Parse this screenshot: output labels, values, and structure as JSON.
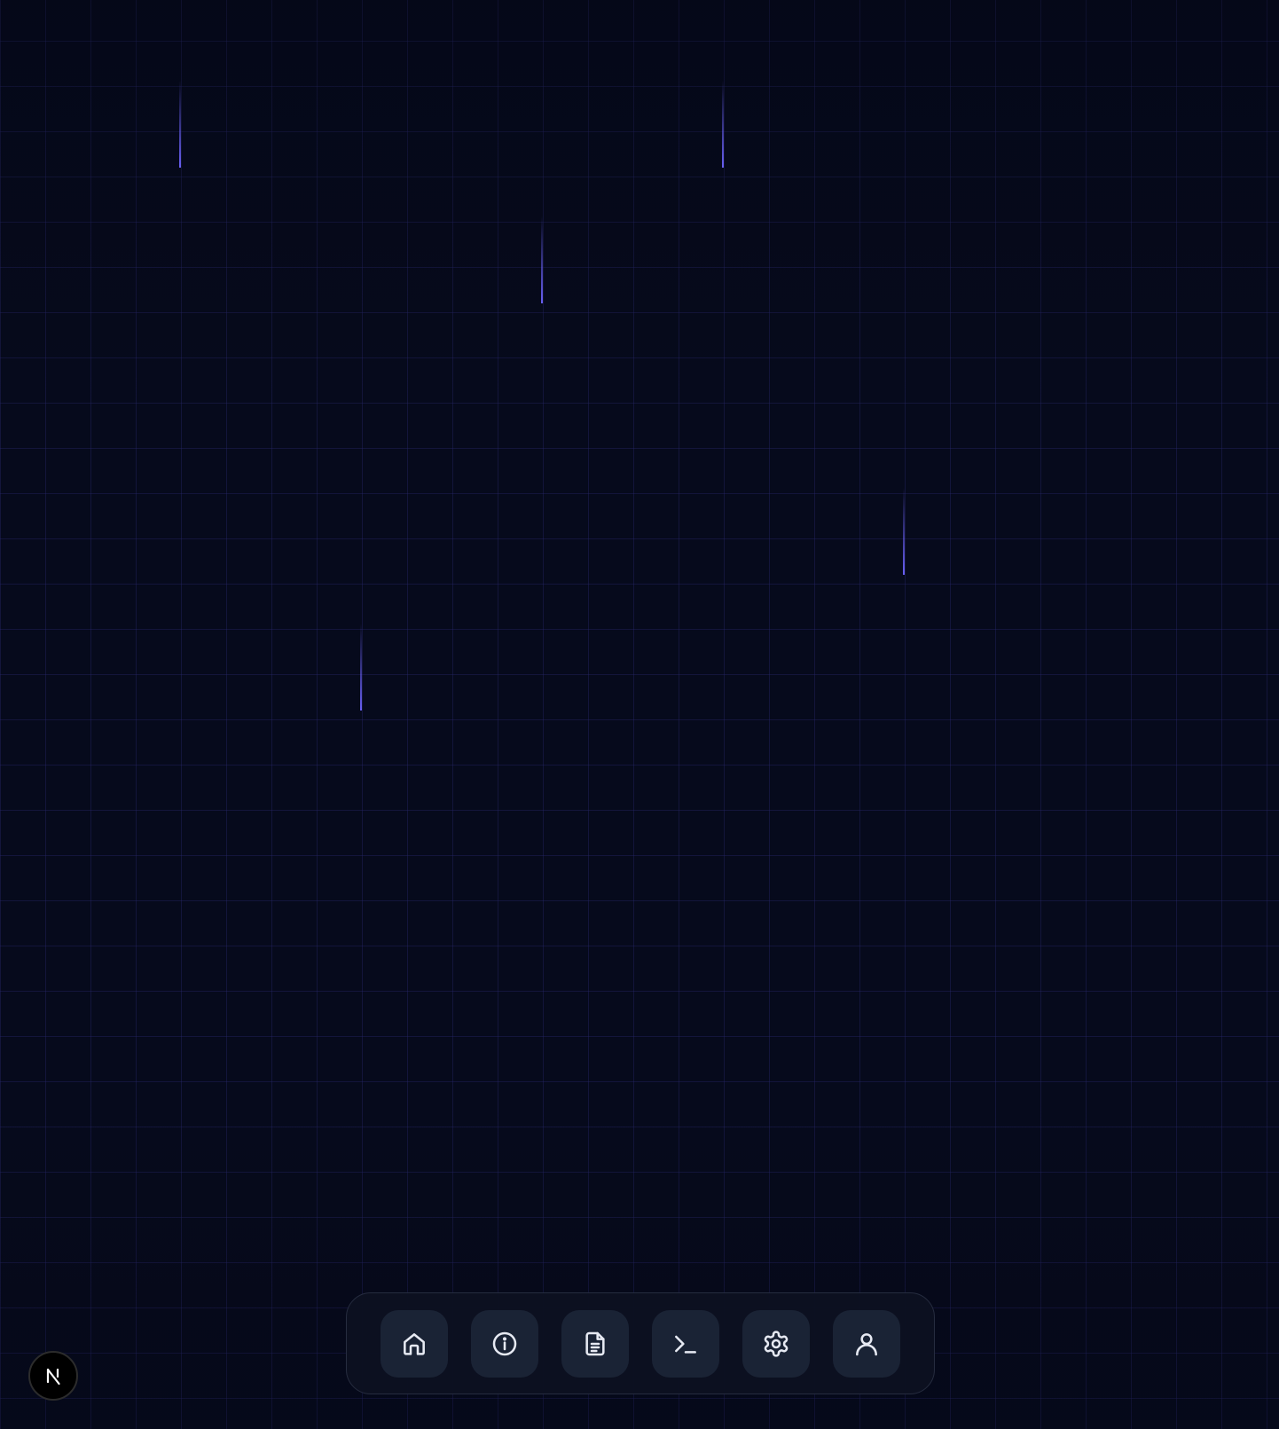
{
  "background": {
    "color": "#060a1c",
    "grid_color": "#1e1e5a",
    "beam_color": "#6366f1"
  },
  "dock": {
    "items": [
      {
        "icon": "home-icon"
      },
      {
        "icon": "info-icon"
      },
      {
        "icon": "document-icon"
      },
      {
        "icon": "terminal-icon"
      },
      {
        "icon": "gear-icon"
      },
      {
        "icon": "user-icon"
      }
    ]
  },
  "badge": {
    "icon": "nextjs-logo-icon"
  }
}
